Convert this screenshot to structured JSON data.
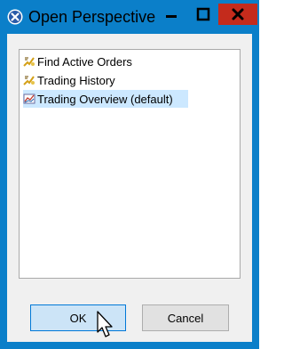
{
  "window": {
    "title": "Open Perspective",
    "controls": {
      "minimize": "minimize",
      "maximize": "maximize",
      "close": "close"
    }
  },
  "perspectives": [
    {
      "label": "Find Active Orders",
      "icon": "perspective-icon",
      "selected": false
    },
    {
      "label": "Trading History",
      "icon": "perspective-icon",
      "selected": false
    },
    {
      "label": "Trading Overview (default)",
      "icon": "chart-icon",
      "selected": true
    }
  ],
  "buttons": {
    "ok": "OK",
    "cancel": "Cancel"
  },
  "colors": {
    "titlebar": "#0b7fc9",
    "close": "#c42b1c",
    "selection": "#cce8ff",
    "ok_button": "#cce4f7"
  }
}
